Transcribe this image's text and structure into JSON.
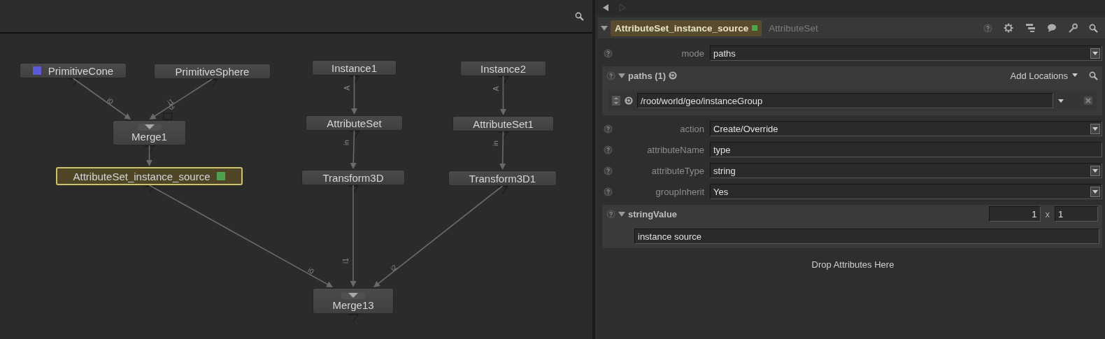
{
  "node_graph": {
    "nodes": [
      {
        "name": "PrimitiveCone",
        "kind": "node",
        "color": "#5b5bd6",
        "selected": false,
        "edited": false
      },
      {
        "name": "PrimitiveSphere",
        "kind": "node",
        "selected": false,
        "edited": false
      },
      {
        "name": "Merge1",
        "kind": "merge",
        "selected": false,
        "edited": false,
        "open_inputs": [
          "i2"
        ]
      },
      {
        "name": "AttributeSet_instance_source",
        "kind": "node",
        "selected": true,
        "edited": true
      },
      {
        "name": "Instance1",
        "kind": "node",
        "selected": false,
        "edited": false
      },
      {
        "name": "AttributeSet",
        "kind": "node",
        "selected": false,
        "edited": false
      },
      {
        "name": "Transform3D",
        "kind": "node",
        "selected": false,
        "edited": false
      },
      {
        "name": "Instance2",
        "kind": "node",
        "selected": false,
        "edited": false
      },
      {
        "name": "AttributeSet1",
        "kind": "node",
        "selected": false,
        "edited": false
      },
      {
        "name": "Transform3D1",
        "kind": "node",
        "selected": false,
        "edited": false
      },
      {
        "name": "Merge13",
        "kind": "merge",
        "selected": false,
        "edited": false
      }
    ],
    "edges": [
      {
        "label": "i0"
      },
      {
        "label": "i1"
      },
      {
        "label": "A"
      },
      {
        "label": "in"
      },
      {
        "label": "A"
      },
      {
        "label": "in"
      },
      {
        "label": "i0"
      },
      {
        "label": "i1"
      },
      {
        "label": "i2"
      }
    ]
  },
  "parameters_panel": {
    "history_buttons": [
      {
        "kind": "back",
        "disabled": false
      },
      {
        "kind": "forward",
        "disabled": true
      }
    ],
    "header": {
      "expanded": true,
      "node_name": "AttributeSet_instance_source",
      "edited": true,
      "node_type": "AttributeSet"
    },
    "parameters": [
      {
        "kind": "dropdown",
        "label": "mode",
        "value": "paths"
      },
      {
        "kind": "group",
        "label": "paths (1)",
        "expanded": true,
        "action": "Add Locations",
        "items": [
          {
            "kind": "path",
            "value": "/root/world/geo/instanceGroup"
          }
        ]
      },
      {
        "kind": "dropdown",
        "label": "action",
        "value": "Create/Override"
      },
      {
        "kind": "text",
        "label": "attributeName",
        "value": "type"
      },
      {
        "kind": "dropdown",
        "label": "attributeType",
        "value": "string"
      },
      {
        "kind": "dropdown",
        "label": "groupInherit",
        "value": "Yes"
      },
      {
        "kind": "array",
        "label": "stringValue",
        "expanded": true,
        "size": [
          "1",
          "1"
        ],
        "separator": "x",
        "items": [
          {
            "kind": "text",
            "value": "instance source"
          }
        ]
      }
    ],
    "drop_hint": "Drop Attributes Here"
  }
}
